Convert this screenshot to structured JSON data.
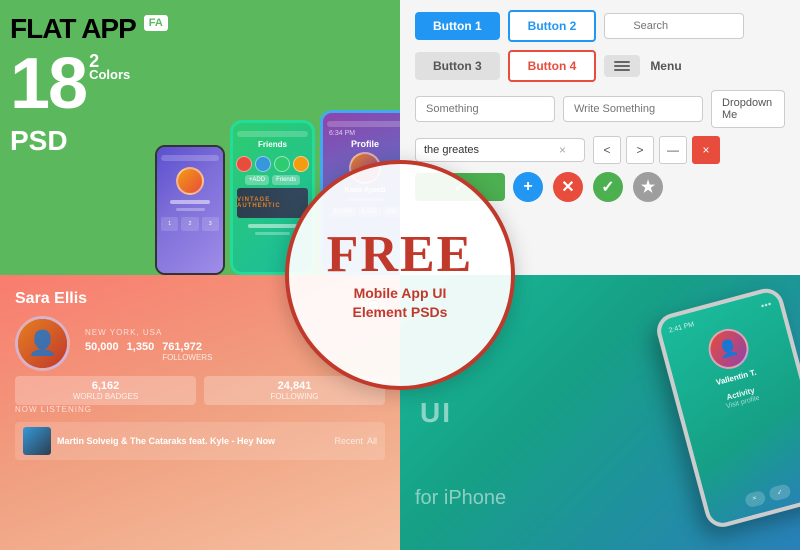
{
  "panels": {
    "top_left": {
      "title": "FLAT APP",
      "badge": "FA",
      "number": "18",
      "superscript": "2",
      "colors_label": "Colors",
      "psd_label": "PSD",
      "phones": [
        {
          "type": "small",
          "screen": "profile"
        },
        {
          "type": "medium",
          "screen": "friends"
        },
        {
          "type": "large",
          "screen": "vintage"
        }
      ]
    },
    "top_right": {
      "buttons": [
        {
          "label": "Button 1",
          "style": "blue"
        },
        {
          "label": "Button 2",
          "style": "outline-blue"
        },
        {
          "label": "Button 3",
          "style": "gray"
        },
        {
          "label": "Button 4",
          "style": "red-outline"
        }
      ],
      "menu_label": "Menu",
      "search_placeholder": "Search",
      "input_placeholder1": "Something",
      "input_placeholder2": "Write Something",
      "input_value": "the greates",
      "dropdown_label": "Dropdown Me",
      "nav_buttons": [
        "<",
        ">",
        "—",
        "×"
      ],
      "action_icons": [
        "+",
        "×",
        "✓",
        "★"
      ],
      "checkmark": "✓"
    },
    "bottom_left": {
      "profile_name": "Sara Ellis",
      "location": "NEW YORK, USA",
      "stats": [
        {
          "number": "50,000",
          "label": ""
        },
        {
          "number": "1,350",
          "label": ""
        },
        {
          "number": "761,972",
          "label": "FOLLOWERS"
        }
      ],
      "stats2": [
        {
          "number": "6,162",
          "label": "WORLD BADGES"
        },
        {
          "number": "24,841",
          "label": "FOLLOWING"
        }
      ],
      "now_playing": "Now Listening",
      "song_title": "Martin Solveig & The Cataraks feat. Kyle - Hey Now",
      "recent_label": "Recent",
      "all_label": "All"
    },
    "bottom_right": {
      "ui_text": "UI",
      "for_iphone": "for iPhone",
      "user_name": "Vallentin T.",
      "activity_label": "Activity",
      "visit_profile": "Visit profile",
      "time": "2:41 PM"
    }
  },
  "overlay": {
    "free_text": "FREE",
    "subtitle_line1": "Mobile App UI",
    "subtitle_line2": "Element PSDs"
  }
}
